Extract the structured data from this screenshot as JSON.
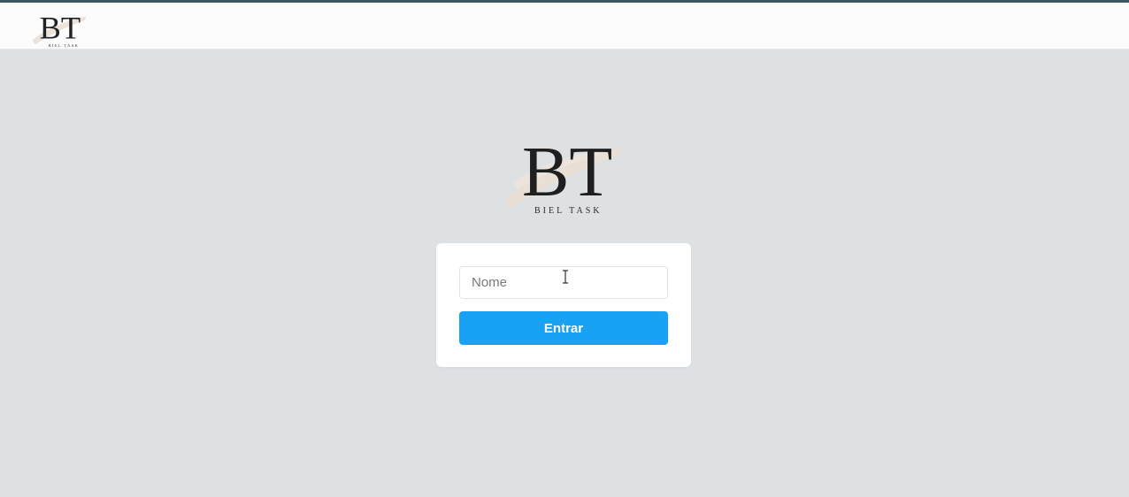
{
  "brand": {
    "monogram": "BT",
    "name": "BIEL TASK"
  },
  "login": {
    "name_placeholder": "Nome",
    "name_value": "",
    "submit_label": "Entrar"
  },
  "colors": {
    "top_rule": "#3d555f",
    "background": "#dde1e4",
    "button": "#19a2f3"
  },
  "icons": {
    "cursor": "text-cursor-icon"
  }
}
